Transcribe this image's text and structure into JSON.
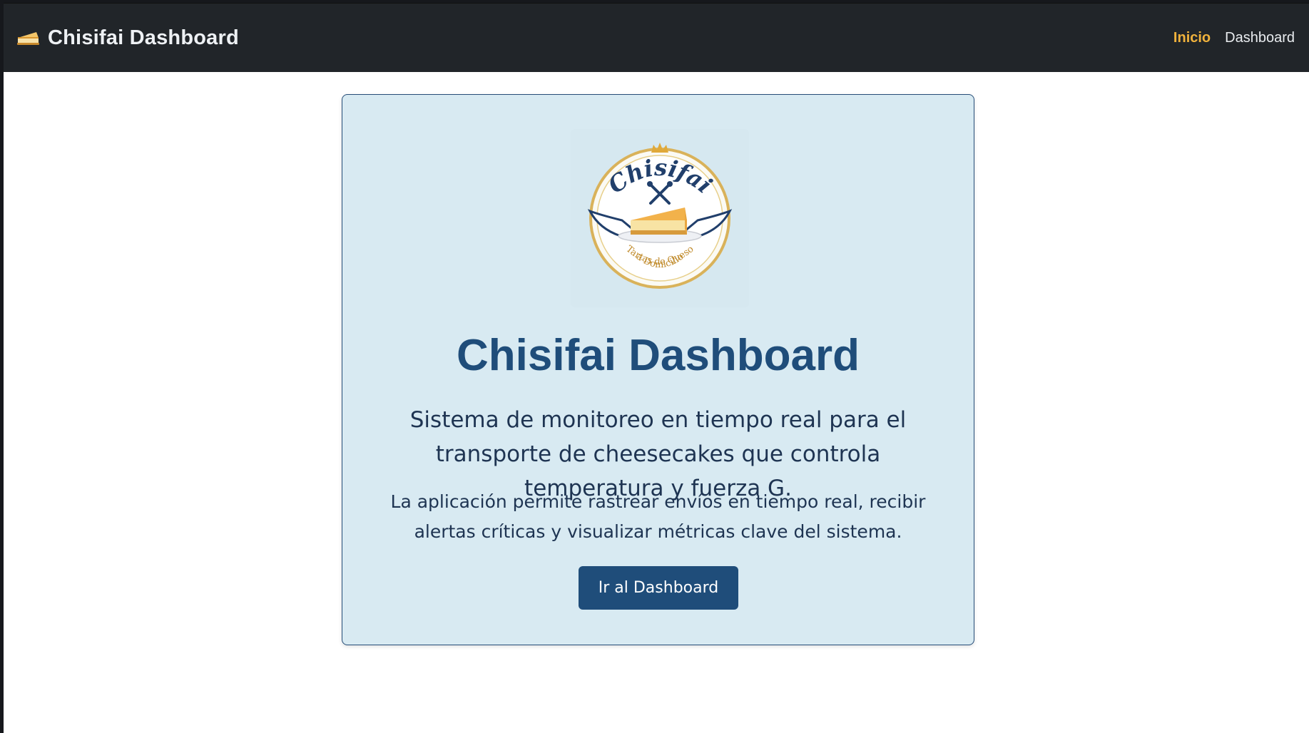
{
  "navbar": {
    "brand_icon": "cheesecake-slice-icon",
    "brand_title": "Chisifai Dashboard",
    "links": [
      {
        "label": "Inicio",
        "active": true
      },
      {
        "label": "Dashboard",
        "active": false
      }
    ],
    "accent_color": "#f0b23c"
  },
  "hero": {
    "logo": {
      "brand_text": "Chisifai",
      "tagline_line1": "Tartas de Queso",
      "tagline_line2": "a Domicilio"
    },
    "title": "Chisifai Dashboard",
    "lead": "Sistema de monitoreo en tiempo real para el transporte de cheesecakes que controla temperatura y fuerza G.",
    "description": "La aplicación permite rastrear envíos en tiempo real, recibir alertas críticas y visualizar métricas clave del sistema.",
    "cta_label": "Ir al Dashboard",
    "colors": {
      "card_background": "#d8eaf2",
      "primary": "#1f4d7a",
      "navbar": "#212529"
    }
  }
}
